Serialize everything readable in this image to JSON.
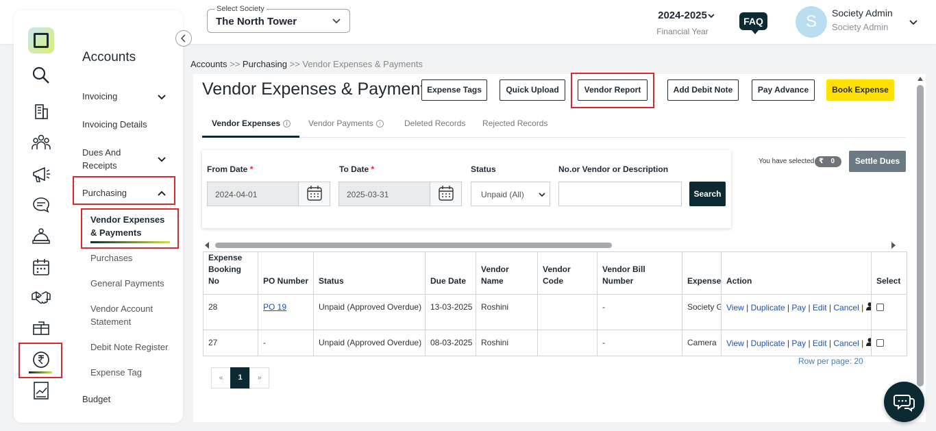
{
  "header": {
    "society_label": "Select Society",
    "society_value": "The North Tower",
    "fy_year": "2024-2025",
    "fy_label": "Financial Year",
    "faq": "FAQ",
    "avatar_initial": "S",
    "user_name": "Society Admin",
    "user_role": "Society Admin"
  },
  "sidebar": {
    "title": "Accounts",
    "items": [
      {
        "label": "Invoicing"
      },
      {
        "label": "Invoicing Details"
      },
      {
        "label": "Dues And Receipts"
      },
      {
        "label": "Purchasing"
      },
      {
        "label": "Budget"
      }
    ],
    "sub_items": [
      {
        "label": "Vendor Expenses & Payments"
      },
      {
        "label": "Purchases"
      },
      {
        "label": "General Payments"
      },
      {
        "label": "Vendor Account Statement"
      },
      {
        "label": "Debit Note Register"
      },
      {
        "label": "Expense Tag"
      }
    ],
    "rail_icons": [
      "search-icon",
      "building-icon",
      "people-icon",
      "megaphone-icon",
      "chat-icon",
      "service-icon",
      "calendar-icon",
      "handshake-icon",
      "amenity-icon",
      "rupee-icon",
      "report-icon"
    ]
  },
  "breadcrumb": {
    "accounts": "Accounts",
    "sep1": " >> ",
    "purchasing": "Purchasing",
    "current": " >> Vendor Expenses & Payments"
  },
  "page": {
    "title": "Vendor Expenses & Payments",
    "buttons": {
      "expense_tags": "Expense Tags",
      "quick_upload": "Quick Upload",
      "vendor_report": "Vendor Report",
      "add_debit_note": "Add Debit Note",
      "pay_advance": "Pay Advance",
      "book_expense": "Book Expense"
    },
    "tabs": [
      "Vendor Expenses",
      "Vendor Payments",
      "Deleted Records",
      "Rejected Records"
    ]
  },
  "filters": {
    "from_date_label": "From Date",
    "from_date": "2024-04-01",
    "to_date_label": "To Date",
    "to_date": "2025-03-31",
    "status_label": "Status",
    "status_value": "Unpaid (All)",
    "search_label": "No.or Vendor or Description",
    "search_value": "",
    "search_button": "Search",
    "required_mark": "*"
  },
  "selection": {
    "text": "You have selected",
    "currency": "₹",
    "count": "0",
    "settle_button": "Settle Dues"
  },
  "table": {
    "headers": [
      "Expense Booking No",
      "PO Number",
      "Status",
      "Due Date",
      "Vendor Name",
      "Vendor Code",
      "Vendor Bill Number",
      "Expense",
      "Action",
      "Select"
    ],
    "rows": [
      {
        "booking_no": "28",
        "po": "PO 19",
        "status": "Unpaid (Approved Overdue)",
        "due": "13-03-2025",
        "vendor": "Roshini",
        "code": "",
        "bill": "-",
        "expense": "Society G"
      },
      {
        "booking_no": "27",
        "po": "-",
        "status": "Unpaid (Approved Overdue)",
        "due": "08-03-2025",
        "vendor": "Roshini",
        "code": "",
        "bill": "-",
        "expense": "Camera"
      }
    ],
    "actions": {
      "view": "View",
      "duplicate": "Duplicate",
      "pay": "Pay",
      "edit": "Edit",
      "cancel": "Cancel",
      "sep": " | "
    }
  },
  "pagination": {
    "prev": "«",
    "current": "1",
    "next": "»",
    "rows_per_page": "Row per page: 20"
  },
  "colors": {
    "brand_dark": "#0d2a33",
    "accent_yellow": "#ffe100",
    "highlight_red": "#e0262b",
    "link_blue": "#1a52c2"
  }
}
